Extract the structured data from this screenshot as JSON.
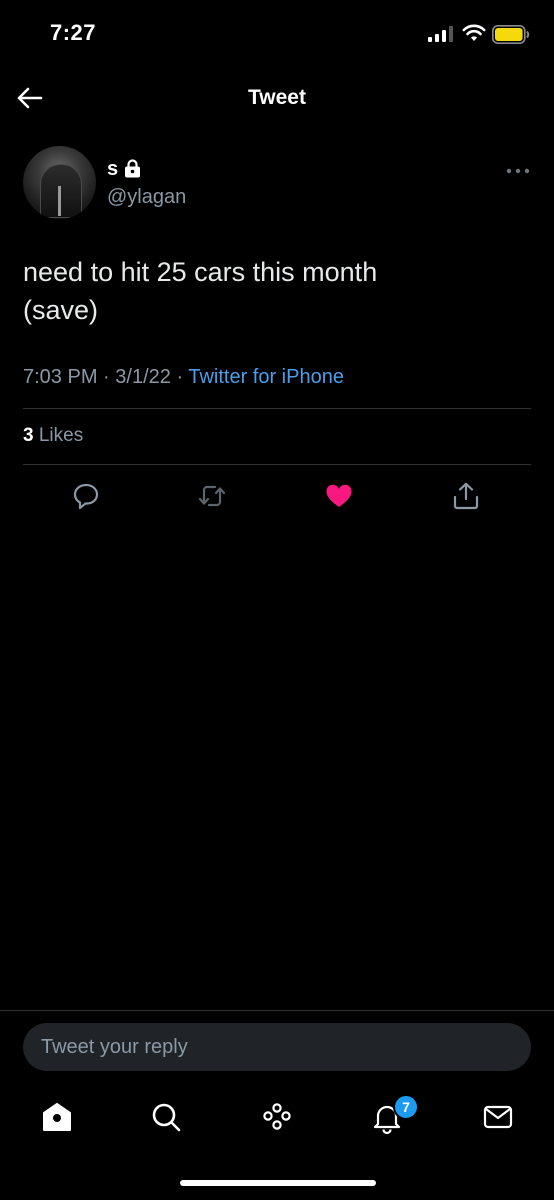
{
  "status_bar": {
    "time": "7:27",
    "icons": [
      "cellular-signal-icon",
      "wifi-icon",
      "battery-icon"
    ],
    "battery_color": "#f5d90a"
  },
  "header": {
    "title": "Tweet",
    "back_icon": "arrow-left-icon"
  },
  "tweet": {
    "author": {
      "display_name": "s",
      "username": "@ylagan",
      "protected_icon": "lock-icon"
    },
    "text_line_1": "need to hit 25 cars this month",
    "text_line_2": "(save)",
    "time": "7:03 PM",
    "separator": "·",
    "date": "3/1/22",
    "source": "Twitter for iPhone",
    "likes": {
      "count": "3",
      "label": "Likes"
    },
    "actions": [
      "reply-icon",
      "retweet-icon",
      "like-icon",
      "share-icon"
    ],
    "liked": true
  },
  "reply": {
    "placeholder": "Tweet your reply"
  },
  "tab_bar": {
    "items": [
      "home-icon",
      "search-icon",
      "spaces-icon",
      "notifications-icon",
      "messages-icon"
    ],
    "notifications_badge": "7"
  },
  "colors": {
    "background": "#000000",
    "text_primary": "#e7e9ea",
    "text_secondary": "#8b98a5",
    "link": "#4a9eea",
    "like": "#f91880",
    "badge": "#1d9bf0"
  }
}
